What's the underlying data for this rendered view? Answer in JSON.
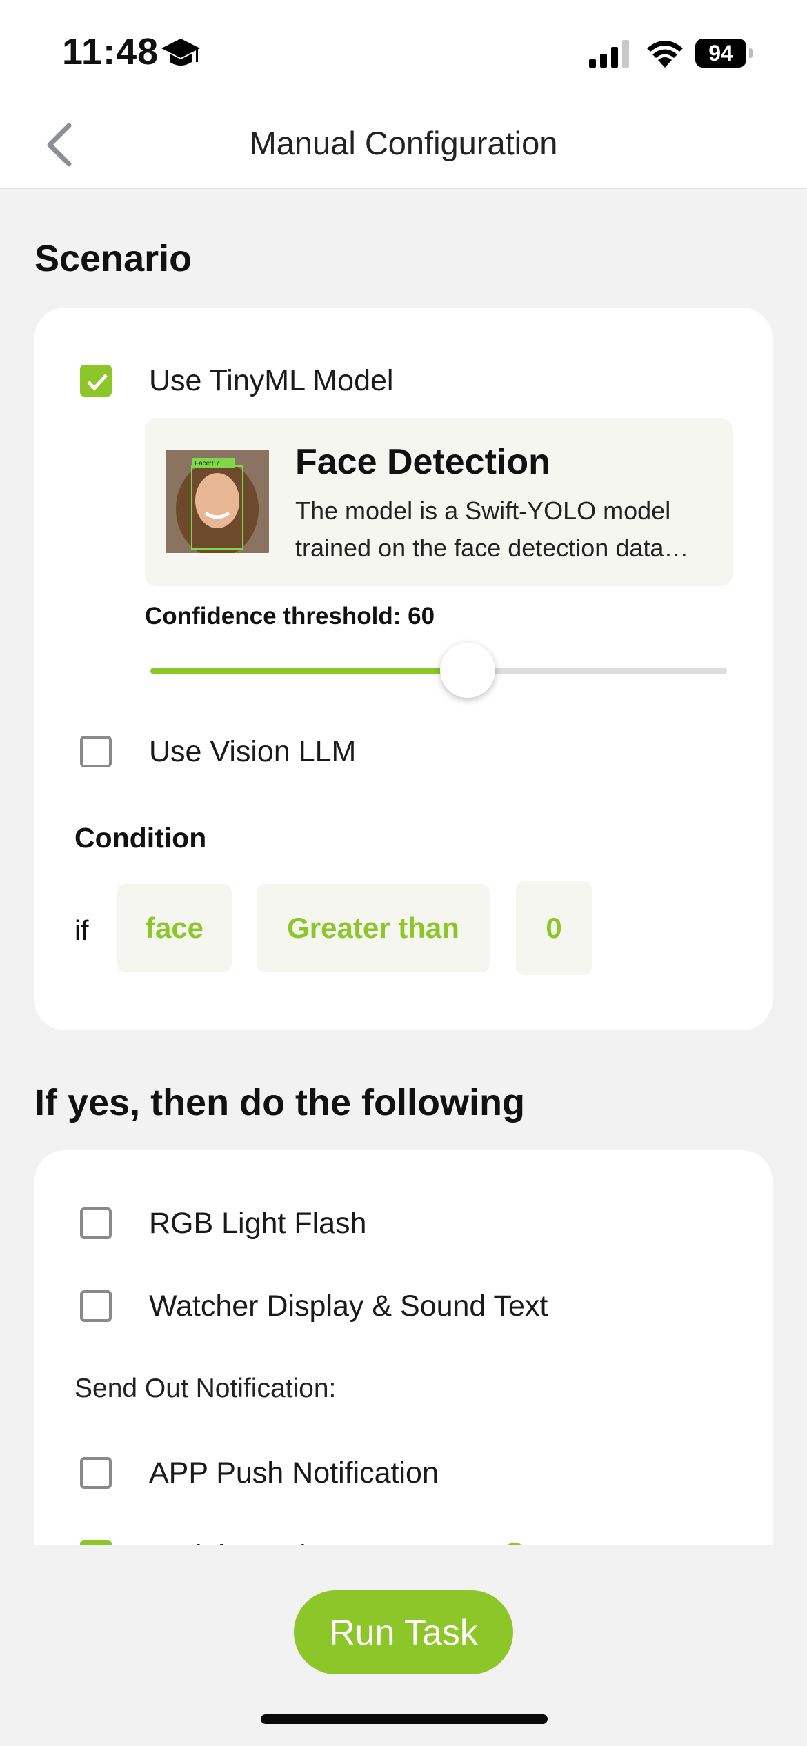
{
  "status_bar": {
    "time": "11:48",
    "battery": "94",
    "icons": [
      "graduation-cap-icon",
      "cellular-signal-icon",
      "wifi-icon",
      "battery-icon"
    ]
  },
  "nav": {
    "title": "Manual Configuration",
    "back_icon": "chevron-left-icon"
  },
  "scenario": {
    "title": "Scenario",
    "tinyml": {
      "label": "Use TinyML Model",
      "checked": true,
      "model": {
        "name": "Face Detection",
        "description": "The model is a Swift-YOLO model trained on the face detection data…",
        "thumbnail_badge": "Face:87"
      },
      "confidence_label": "Confidence threshold: 60",
      "confidence_value": 60,
      "confidence_fraction": 0.6
    },
    "vision_llm": {
      "label": "Use Vision LLM",
      "checked": false
    },
    "condition": {
      "title": "Condition",
      "if_label": "if",
      "object": "face",
      "operator": "Greater than",
      "value": "0"
    }
  },
  "actions": {
    "title": "If yes, then do the following",
    "rgb": {
      "label": "RGB Light Flash",
      "checked": false
    },
    "watcher": {
      "label": "Watcher Display & Sound Text",
      "checked": false
    },
    "notify_label": "Send Out Notification:",
    "app_push": {
      "label": "APP Push Notification",
      "checked": false
    },
    "serial": {
      "label": "Serial Port / UART Output",
      "checked": true
    }
  },
  "footer": {
    "run_label": "Run Task"
  },
  "colors": {
    "accent": "#8cc629",
    "background": "#f2f2f2",
    "card": "#ffffff",
    "chip_bg": "#f6f6f1"
  }
}
